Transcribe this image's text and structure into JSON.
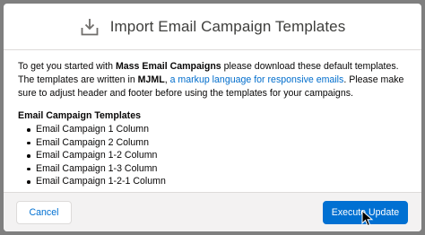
{
  "modal": {
    "title": "Import Email Campaign Templates",
    "header_icon": "download-icon"
  },
  "body": {
    "intro_part1": "To get you started with ",
    "intro_bold1": "Mass Email Campaigns",
    "intro_part2": " please download these default templates. The templates are written in ",
    "intro_bold2": "MJML",
    "intro_part3": ", ",
    "intro_link": "a markup language for responsive emails",
    "intro_part4": ". Please make sure to adjust header and footer before using the templates for your campaigns.",
    "list_title": "Email Campaign Templates",
    "templates": [
      "Email Campaign 1 Column",
      "Email Campaign 2 Column",
      "Email Campaign 1-2 Column",
      "Email Campaign 1-3 Column",
      "Email Campaign 1-2-1 Column"
    ]
  },
  "footer": {
    "cancel_label": "Cancel",
    "execute_label": "Execute Update"
  },
  "colors": {
    "overlay": "#7f7f7f",
    "brand": "#0070d2",
    "link": "#006dcc",
    "footer_bg": "#f3f2f2",
    "border": "#dddbda"
  }
}
